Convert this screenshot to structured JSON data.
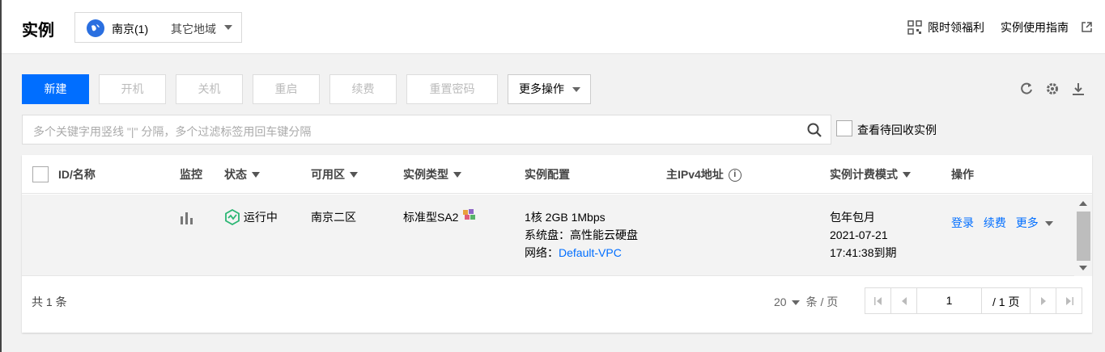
{
  "header": {
    "title": "实例",
    "region_current": "南京(1)",
    "region_other": "其它地域",
    "link_welfare": "限时领福利",
    "link_guide": "实例使用指南"
  },
  "toolbar": {
    "new_label": "新建",
    "start_label": "开机",
    "shutdown_label": "关机",
    "restart_label": "重启",
    "renew_label": "续费",
    "reset_password_label": "重置密码",
    "more_actions_label": "更多操作"
  },
  "search": {
    "placeholder": "多个关键字用竖线 \"|\" 分隔，多个过滤标签用回车键分隔",
    "recycle_label": "查看待回收实例"
  },
  "table": {
    "columns": {
      "id_name": "ID/名称",
      "monitor": "监控",
      "status": "状态",
      "zone": "可用区",
      "instance_type": "实例类型",
      "config": "实例配置",
      "ipv4": "主IPv4地址",
      "billing": "实例计费模式",
      "actions": "操作"
    },
    "rows": [
      {
        "status": "运行中",
        "zone": "南京二区",
        "instance_type": "标准型SA2",
        "config_line1": "1核 2GB 1Mbps",
        "config_line2": "系统盘：高性能云硬盘",
        "network_label": "网络：",
        "network_value": "Default-VPC",
        "billing_line1": "包年包月",
        "billing_line2": "2021-07-21",
        "billing_line3": "17:41:38到期",
        "action_login": "登录",
        "action_renew": "续费",
        "action_more": "更多"
      }
    ]
  },
  "footer": {
    "total": "共 1 条",
    "page_size": "20",
    "page_size_unit": "条 / 页",
    "current_page": "1",
    "total_pages": "/ 1 页"
  },
  "colors": {
    "primary": "#006eff",
    "running": "#2bb673"
  }
}
